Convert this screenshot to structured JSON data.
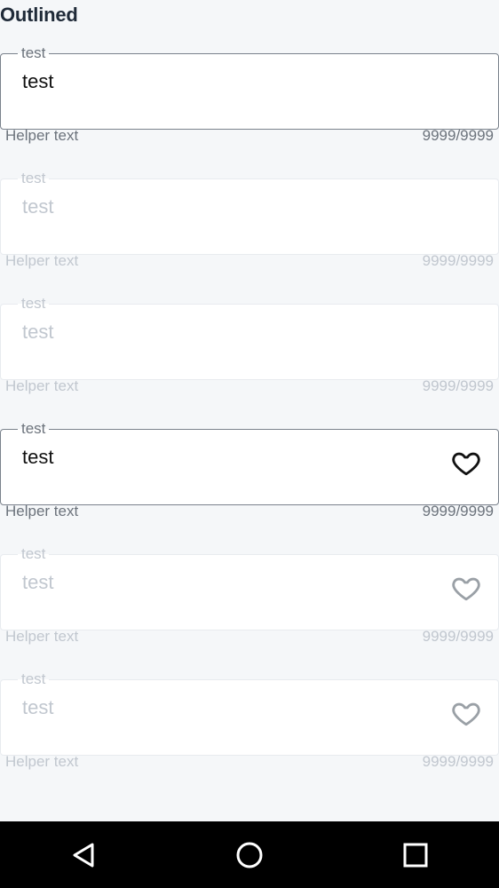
{
  "page": {
    "section_title": "Outlined"
  },
  "fields": [
    {
      "label": "test",
      "value": "test",
      "helper": "Helper text",
      "counter": "9999/9999",
      "state": "enabled",
      "icon": "none"
    },
    {
      "label": "test",
      "value": "test",
      "helper": "Helper text",
      "counter": "9999/9999",
      "state": "disabled",
      "icon": "none"
    },
    {
      "label": "test",
      "value": "test",
      "helper": "Helper text",
      "counter": "9999/9999",
      "state": "disabled",
      "icon": "none"
    },
    {
      "label": "test",
      "value": "test",
      "helper": "Helper text",
      "counter": "9999/9999",
      "state": "enabled",
      "icon": "heart-icon"
    },
    {
      "label": "test",
      "value": "test",
      "helper": "Helper text",
      "counter": "9999/9999",
      "state": "disabled",
      "icon": "heart-icon"
    },
    {
      "label": "test",
      "value": "test",
      "helper": "Helper text",
      "counter": "9999/9999",
      "state": "disabled",
      "icon": "heart-icon"
    }
  ],
  "colors": {
    "background": "#f5f7f9",
    "border_enabled": "#7a828c",
    "border_disabled": "#e8ebef",
    "text_enabled": "#111111",
    "text_muted": "#6c737c",
    "text_disabled": "#c1c7cf",
    "navbar": "#000000"
  },
  "navbar": {
    "buttons": [
      "back-icon",
      "home-icon",
      "recents-icon"
    ]
  }
}
